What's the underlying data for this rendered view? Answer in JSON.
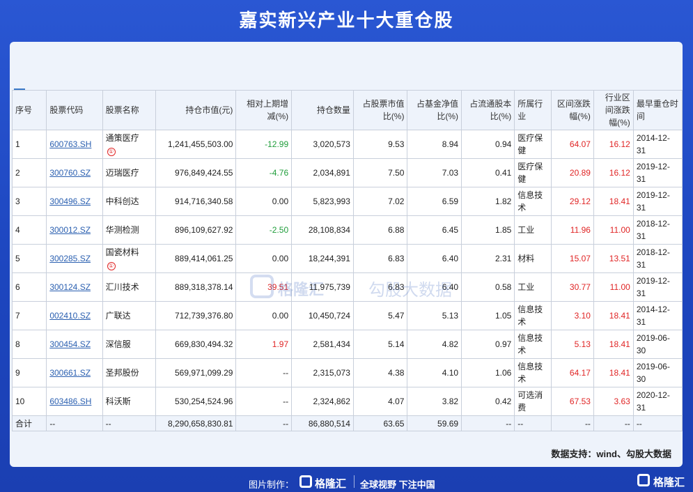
{
  "title": "嘉实新兴产业十大重仓股",
  "headers": [
    "序号",
    "股票代码",
    "股票名称",
    "持仓市值(元)",
    "相对上期增减(%)",
    "持仓数量",
    "占股票市值比(%)",
    "占基金净值比(%)",
    "占流通股本比(%)",
    "所属行业",
    "区间涨跌幅(%)",
    "行业区间涨跌幅(%)",
    "最早重仓时间"
  ],
  "rows": [
    {
      "idx": "1",
      "code": "600763.SH",
      "name": "通策医疗",
      "flag": true,
      "flag_symbol": "①",
      "value": "1,241,455,503.00",
      "change": "-12.99",
      "change_sign": "neg",
      "qty": "3,020,573",
      "stock_pct": "9.53",
      "nav_pct": "8.94",
      "float_pct": "0.94",
      "industry": "医疗保健",
      "range": "64.07",
      "ind_range": "16.12",
      "earliest": "2014-12-31"
    },
    {
      "idx": "2",
      "code": "300760.SZ",
      "name": "迈瑞医疗",
      "flag": false,
      "flag_symbol": "",
      "value": "976,849,424.55",
      "change": "-4.76",
      "change_sign": "neg",
      "qty": "2,034,891",
      "stock_pct": "7.50",
      "nav_pct": "7.03",
      "float_pct": "0.41",
      "industry": "医疗保健",
      "range": "20.89",
      "ind_range": "16.12",
      "earliest": "2019-12-31"
    },
    {
      "idx": "3",
      "code": "300496.SZ",
      "name": "中科创达",
      "flag": false,
      "flag_symbol": "",
      "value": "914,716,340.58",
      "change": "0.00",
      "change_sign": "zero",
      "qty": "5,823,993",
      "stock_pct": "7.02",
      "nav_pct": "6.59",
      "float_pct": "1.82",
      "industry": "信息技术",
      "range": "29.12",
      "ind_range": "18.41",
      "earliest": "2019-12-31"
    },
    {
      "idx": "4",
      "code": "300012.SZ",
      "name": "华测检测",
      "flag": false,
      "flag_symbol": "",
      "value": "896,109,627.92",
      "change": "-2.50",
      "change_sign": "neg",
      "qty": "28,108,834",
      "stock_pct": "6.88",
      "nav_pct": "6.45",
      "float_pct": "1.85",
      "industry": "工业",
      "range": "11.96",
      "ind_range": "11.00",
      "earliest": "2018-12-31"
    },
    {
      "idx": "5",
      "code": "300285.SZ",
      "name": "国瓷材料",
      "flag": true,
      "flag_symbol": "①",
      "value": "889,414,061.25",
      "change": "0.00",
      "change_sign": "zero",
      "qty": "18,244,391",
      "stock_pct": "6.83",
      "nav_pct": "6.40",
      "float_pct": "2.31",
      "industry": "材料",
      "range": "15.07",
      "ind_range": "13.51",
      "earliest": "2018-12-31"
    },
    {
      "idx": "6",
      "code": "300124.SZ",
      "name": "汇川技术",
      "flag": false,
      "flag_symbol": "",
      "value": "889,318,378.14",
      "change": "39.51",
      "change_sign": "pos",
      "qty": "11,975,739",
      "stock_pct": "6.83",
      "nav_pct": "6.40",
      "float_pct": "0.58",
      "industry": "工业",
      "range": "30.77",
      "ind_range": "11.00",
      "earliest": "2019-12-31"
    },
    {
      "idx": "7",
      "code": "002410.SZ",
      "name": "广联达",
      "flag": false,
      "flag_symbol": "",
      "value": "712,739,376.80",
      "change": "0.00",
      "change_sign": "zero",
      "qty": "10,450,724",
      "stock_pct": "5.47",
      "nav_pct": "5.13",
      "float_pct": "1.05",
      "industry": "信息技术",
      "range": "3.10",
      "ind_range": "18.41",
      "earliest": "2014-12-31"
    },
    {
      "idx": "8",
      "code": "300454.SZ",
      "name": "深信服",
      "flag": false,
      "flag_symbol": "",
      "value": "669,830,494.32",
      "change": "1.97",
      "change_sign": "pos",
      "qty": "2,581,434",
      "stock_pct": "5.14",
      "nav_pct": "4.82",
      "float_pct": "0.97",
      "industry": "信息技术",
      "range": "5.13",
      "ind_range": "18.41",
      "earliest": "2019-06-30"
    },
    {
      "idx": "9",
      "code": "300661.SZ",
      "name": "圣邦股份",
      "flag": false,
      "flag_symbol": "",
      "value": "569,971,099.29",
      "change": "--",
      "change_sign": "zero",
      "qty": "2,315,073",
      "stock_pct": "4.38",
      "nav_pct": "4.10",
      "float_pct": "1.06",
      "industry": "信息技术",
      "range": "64.17",
      "ind_range": "18.41",
      "earliest": "2019-06-30"
    },
    {
      "idx": "10",
      "code": "603486.SH",
      "name": "科沃斯",
      "flag": false,
      "flag_symbol": "",
      "value": "530,254,524.96",
      "change": "--",
      "change_sign": "zero",
      "qty": "2,324,862",
      "stock_pct": "4.07",
      "nav_pct": "3.82",
      "float_pct": "0.42",
      "industry": "可选消费",
      "range": "67.53",
      "ind_range": "3.63",
      "earliest": "2020-12-31"
    }
  ],
  "total": {
    "idx": "合计",
    "code": "--",
    "name": "--",
    "value": "8,290,658,830.81",
    "change": "--",
    "qty": "86,880,514",
    "stock_pct": "63.65",
    "nav_pct": "59.69",
    "float_pct": "--",
    "industry": "--",
    "range": "--",
    "ind_range": "--",
    "earliest": "--"
  },
  "watermark": {
    "brand": "格隆汇",
    "product": "勾股大数据"
  },
  "source": "数据支持：wind、勾股大数据",
  "footer": {
    "label": "图片制作：",
    "brand": "格隆汇",
    "slogan": "全球视野 下注中国"
  },
  "corner_brand": "格隆汇",
  "colors": {
    "background": "#1f49c2",
    "negative": "#1f9d3a",
    "positive": "#e02424",
    "link": "#2a5fb0"
  }
}
